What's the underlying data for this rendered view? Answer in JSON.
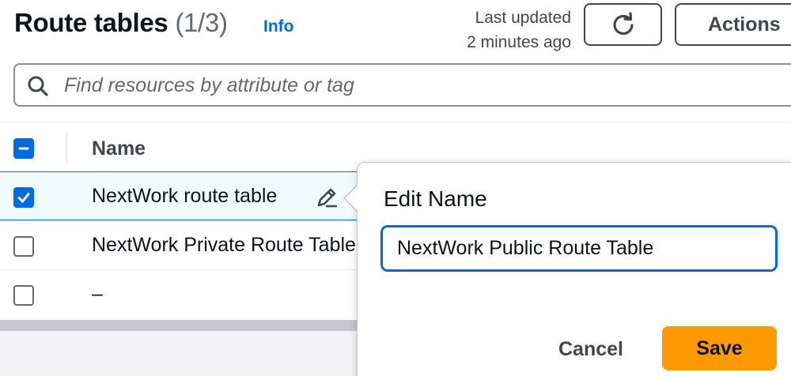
{
  "header": {
    "title": "Route tables",
    "count": "(1/3)",
    "info_link": "Info",
    "last_updated_line1": "Last updated",
    "last_updated_line2": "2 minutes ago",
    "refresh_icon": "refresh-icon",
    "actions_label": "Actions"
  },
  "search": {
    "icon": "search-icon",
    "placeholder": "Find resources by attribute or tag",
    "value": ""
  },
  "table": {
    "header_checkbox_state": "indeterminate",
    "columns": [
      "Name"
    ],
    "rows": [
      {
        "name": "NextWork route table",
        "checked": true,
        "edit_icon": "pencil-icon"
      },
      {
        "name": "NextWork Private Route Table",
        "checked": false
      },
      {
        "name": "–",
        "checked": false
      }
    ]
  },
  "popover": {
    "title": "Edit Name",
    "input_value": "NextWork Public Route Table",
    "cancel_label": "Cancel",
    "save_label": "Save"
  },
  "colors": {
    "accent": "#006ce0",
    "primary_button": "#ff9900",
    "selected_row_bg": "#f0fbff"
  }
}
